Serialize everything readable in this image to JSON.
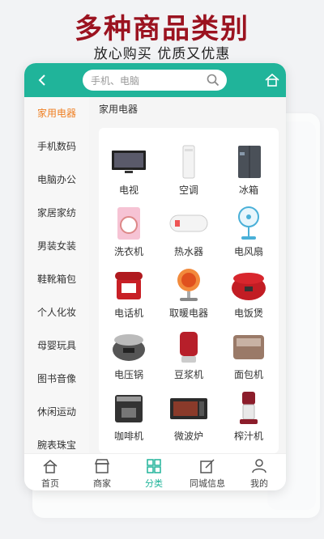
{
  "promo": {
    "title": "多种商品类别",
    "subtitle": "放心购买 优质又优惠"
  },
  "header": {
    "search_placeholder": "手机、电脑"
  },
  "sidebar": {
    "items": [
      {
        "label": "家用电器",
        "active": true
      },
      {
        "label": "手机数码"
      },
      {
        "label": "电脑办公"
      },
      {
        "label": "家居家纺"
      },
      {
        "label": "男装女装"
      },
      {
        "label": "鞋靴箱包"
      },
      {
        "label": "个人化妆"
      },
      {
        "label": "母婴玩具"
      },
      {
        "label": "图书音像"
      },
      {
        "label": "休闲运动"
      },
      {
        "label": "腕表珠宝"
      }
    ]
  },
  "content": {
    "title": "家用电器",
    "products": [
      {
        "label": "电视",
        "icon": "tv-icon"
      },
      {
        "label": "空调",
        "icon": "air-conditioner-icon"
      },
      {
        "label": "冰箱",
        "icon": "fridge-icon"
      },
      {
        "label": "洗衣机",
        "icon": "washing-machine-icon"
      },
      {
        "label": "热水器",
        "icon": "water-heater-icon"
      },
      {
        "label": "电风扇",
        "icon": "fan-icon"
      },
      {
        "label": "电话机",
        "icon": "telephone-icon"
      },
      {
        "label": "取暖电器",
        "icon": "heater-icon"
      },
      {
        "label": "电饭煲",
        "icon": "rice-cooker-icon"
      },
      {
        "label": "电压锅",
        "icon": "pressure-cooker-icon"
      },
      {
        "label": "豆浆机",
        "icon": "soymilk-maker-icon"
      },
      {
        "label": "面包机",
        "icon": "bread-maker-icon"
      },
      {
        "label": "咖啡机",
        "icon": "coffee-machine-icon"
      },
      {
        "label": "微波炉",
        "icon": "microwave-icon"
      },
      {
        "label": "榨汁机",
        "icon": "juicer-icon"
      }
    ]
  },
  "tabbar": {
    "items": [
      {
        "label": "首页",
        "icon": "home-icon"
      },
      {
        "label": "商家",
        "icon": "shop-icon"
      },
      {
        "label": "分类",
        "icon": "category-icon",
        "active": true
      },
      {
        "label": "同城信息",
        "icon": "edit-icon"
      },
      {
        "label": "我的",
        "icon": "user-icon"
      }
    ]
  },
  "colors": {
    "accent": "#20b49a",
    "active_orange": "#ef7f22",
    "promo_red": "#9b1320"
  }
}
